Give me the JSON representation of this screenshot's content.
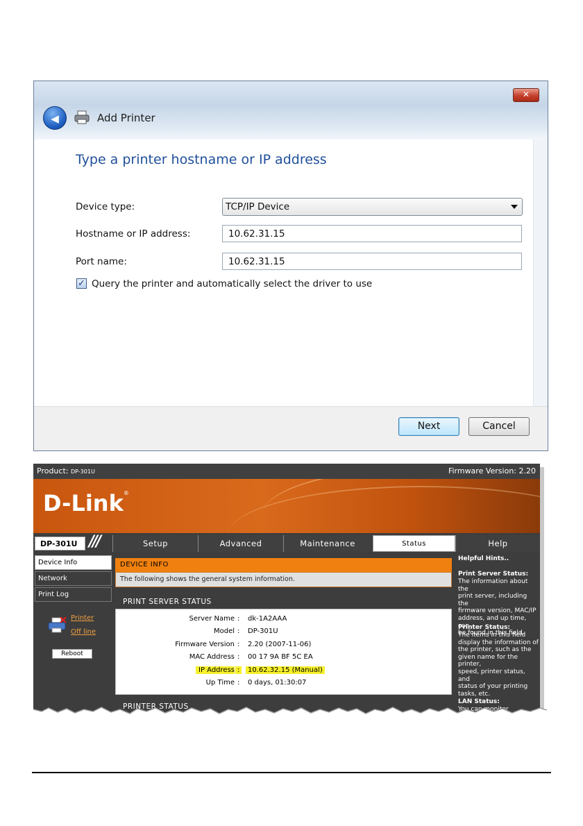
{
  "dialog": {
    "close_glyph": "✕",
    "back_glyph": "◀",
    "title": "Add Printer",
    "heading": "Type a printer hostname or IP address",
    "device_type_label": "Device type:",
    "device_type_value": "TCP/IP Device",
    "hostname_label": "Hostname or IP address:",
    "hostname_value": "10.62.31.15",
    "port_label": "Port name:",
    "port_value": "10.62.31.15",
    "query_label": "Query the printer and automatically select the driver to use",
    "query_checked": true,
    "next_label": "Next",
    "cancel_label": "Cancel",
    "accent_color": "#1f4f9a"
  },
  "dlink": {
    "product_label": "Product:",
    "product_value": "DP-301U",
    "firmware_label": "Firmware Version: 2.20",
    "logo": "D-Link",
    "logo_mark": "®",
    "model": "DP-301U",
    "slashes": "///",
    "tabs": [
      "Setup",
      "Advanced",
      "Maintenance",
      "Status",
      "Help"
    ],
    "active_tab": "Status",
    "sidebar": [
      "Device Info",
      "Network",
      "Print Log"
    ],
    "printer_link": "Printer",
    "offline_link": "Off line",
    "reboot_label": "Reboot",
    "section_title": "DEVICE INFO",
    "section_desc": "The following shows the general system information.",
    "print_server_status_title": "PRINT SERVER STATUS",
    "status_rows": [
      {
        "key": "Server Name",
        "value": "dk-1A2AAA"
      },
      {
        "key": "Model",
        "value": "DP-301U"
      },
      {
        "key": "Firmware Version",
        "value": "2.20 (2007-11-06)"
      },
      {
        "key": "MAC Address",
        "value": "00 17 9A BF 5C EA"
      },
      {
        "key": "IP Address",
        "value": "10.62.32.15 (Manual)"
      },
      {
        "key": "Up Time",
        "value": "0 days, 01:30:07"
      }
    ],
    "separator": ":",
    "printer_status_title": "PRINTER STATUS",
    "hints": {
      "title": "Helpful Hints..",
      "ps_head": "Print Server Status:",
      "ps_text": [
        "The information about the",
        "print server, including the",
        "firmware version, MAC/IP",
        "address, and up time, can",
        "be found in this field."
      ],
      "pr_head": "Printer Status:",
      "pr_text": [
        "The items in this field",
        "display the information of",
        "the printer, such as the",
        "given name for the printer,",
        "speed, printer status, and",
        "status of your printing",
        "tasks, etc."
      ],
      "lan_head": "LAN Status:",
      "lan_text": "You can monitor"
    },
    "orange": "#f08010",
    "highlight": "#f5f02a"
  }
}
